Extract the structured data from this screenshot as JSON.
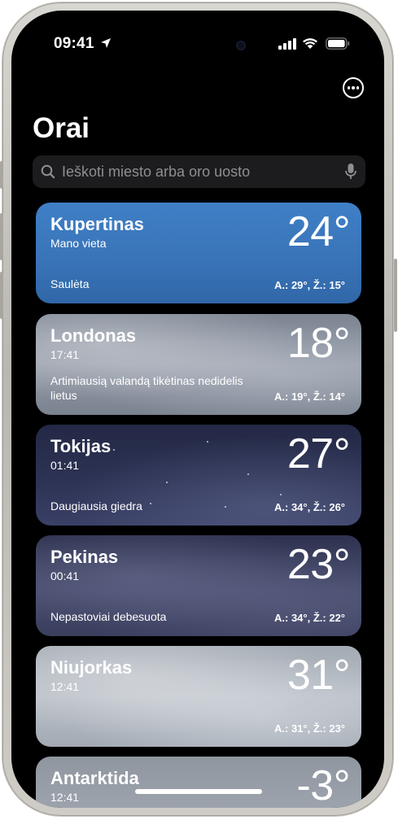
{
  "status_bar": {
    "time": "09:41",
    "icons": [
      "location-arrow-icon",
      "signal-icon",
      "wifi-icon",
      "battery-icon"
    ]
  },
  "header": {
    "more_icon": "ellipsis-circle-icon",
    "title": "Orai"
  },
  "search": {
    "placeholder": "Ieškoti miesto arba oro uosto",
    "icons": [
      "search-icon",
      "mic-icon"
    ]
  },
  "locations": [
    {
      "city": "Kupertinas",
      "subtitle": "Mano vieta",
      "temperature": "24°",
      "condition": "Saulėta",
      "high_low": "A.: 29°, Ž.: 15°",
      "background": "#3a74b8"
    },
    {
      "city": "Londonas",
      "subtitle": "17:41",
      "temperature": "18°",
      "condition": "Artimiausią valandą tikėtinas nedidelis lietus",
      "high_low": "A.: 19°, Ž.: 14°",
      "background": "#8a919d"
    },
    {
      "city": "Tokijas",
      "subtitle": "01:41",
      "temperature": "27°",
      "condition": "Daugiausia giedra",
      "high_low": "A.: 34°, Ž.: 26°",
      "background": "#2b3152"
    },
    {
      "city": "Pekinas",
      "subtitle": "00:41",
      "temperature": "23°",
      "condition": "Nepastoviai debesuota",
      "high_low": "A.: 34°, Ž.: 22°",
      "background": "#40445f"
    },
    {
      "city": "Niujorkas",
      "subtitle": "12:41",
      "temperature": "31°",
      "condition": "",
      "high_low": "A.: 31°, Ž.: 23°",
      "background": "#b1b7bf"
    },
    {
      "city": "Antarktida",
      "subtitle": "12:41",
      "temperature": "-3°",
      "condition": "",
      "high_low": "",
      "background": "#98a0aa"
    }
  ]
}
